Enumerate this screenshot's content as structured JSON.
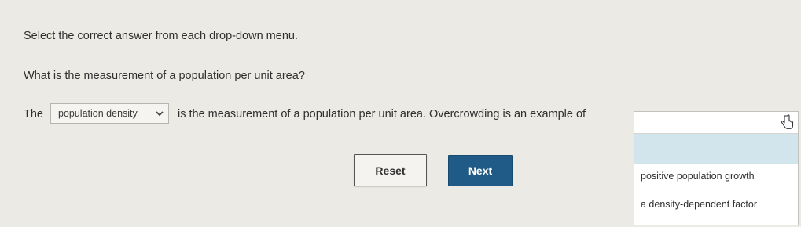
{
  "instruction": "Select the correct answer from each drop-down menu.",
  "question": "What is the measurement of a population per unit area?",
  "sentence": {
    "prefix": "The",
    "dropdown1_value": "population density",
    "suffix": "is the measurement of a population per unit area. Overcrowding is an example of"
  },
  "dropdown2": {
    "selected": "",
    "options": [
      "",
      "positive population growth",
      "a density-dependent factor"
    ]
  },
  "buttons": {
    "reset": "Reset",
    "next": "Next"
  },
  "colors": {
    "accent": "#1f5b86",
    "highlight": "#d3e5ec"
  }
}
